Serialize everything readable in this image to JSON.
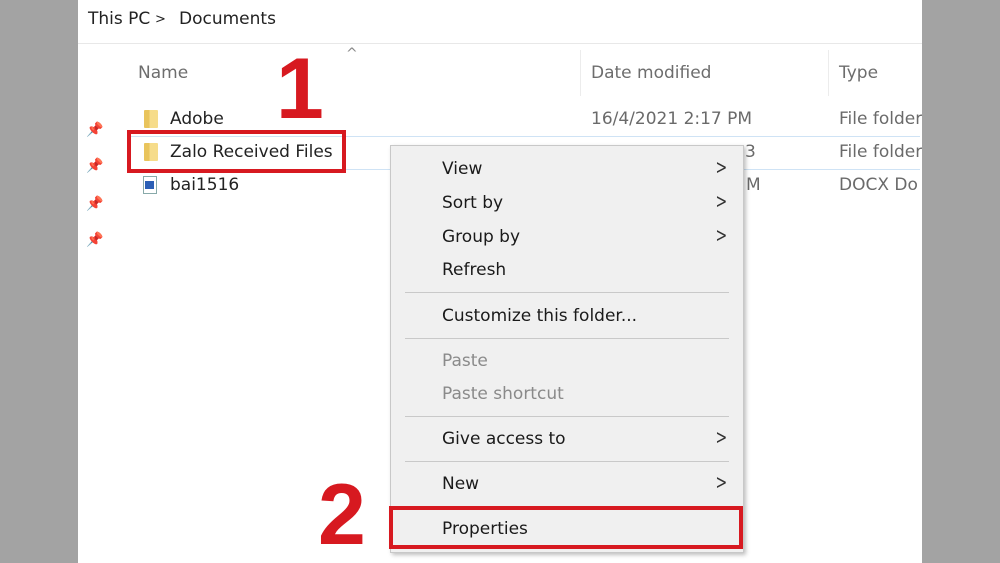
{
  "breadcrumb": {
    "items": [
      "This PC",
      "Documents"
    ],
    "separator": ">"
  },
  "columns": {
    "name": "Name",
    "date": "Date modified",
    "type": "Type",
    "sort_indicator": "^"
  },
  "files": [
    {
      "name": "Adobe",
      "date": "16/4/2021 2:17 PM",
      "type": "File folder",
      "icon": "folder-icon"
    },
    {
      "name": "Zalo Received Files",
      "date_visible_fragment": "3",
      "type": "File folder",
      "icon": "folder-icon",
      "selected": true
    },
    {
      "name": "bai1516",
      "date_visible_fragment": "M",
      "type": "DOCX Do",
      "icon": "docx-icon"
    }
  ],
  "pins": [
    "pin-icon",
    "pin-icon",
    "pin-icon",
    "pin-icon"
  ],
  "context_menu": {
    "items": [
      {
        "label": "View",
        "submenu": true
      },
      {
        "label": "Sort by",
        "submenu": true
      },
      {
        "label": "Group by",
        "submenu": true
      },
      {
        "label": "Refresh"
      },
      {
        "label": "Customize this folder..."
      },
      {
        "label": "Paste",
        "disabled": true
      },
      {
        "label": "Paste shortcut",
        "disabled": true
      },
      {
        "label": "Give access to",
        "submenu": true
      },
      {
        "label": "New",
        "submenu": true
      },
      {
        "label": "Properties",
        "highlighted": true
      }
    ]
  },
  "annotations": {
    "step1": "1",
    "step2": "2",
    "color": "#d71920"
  }
}
